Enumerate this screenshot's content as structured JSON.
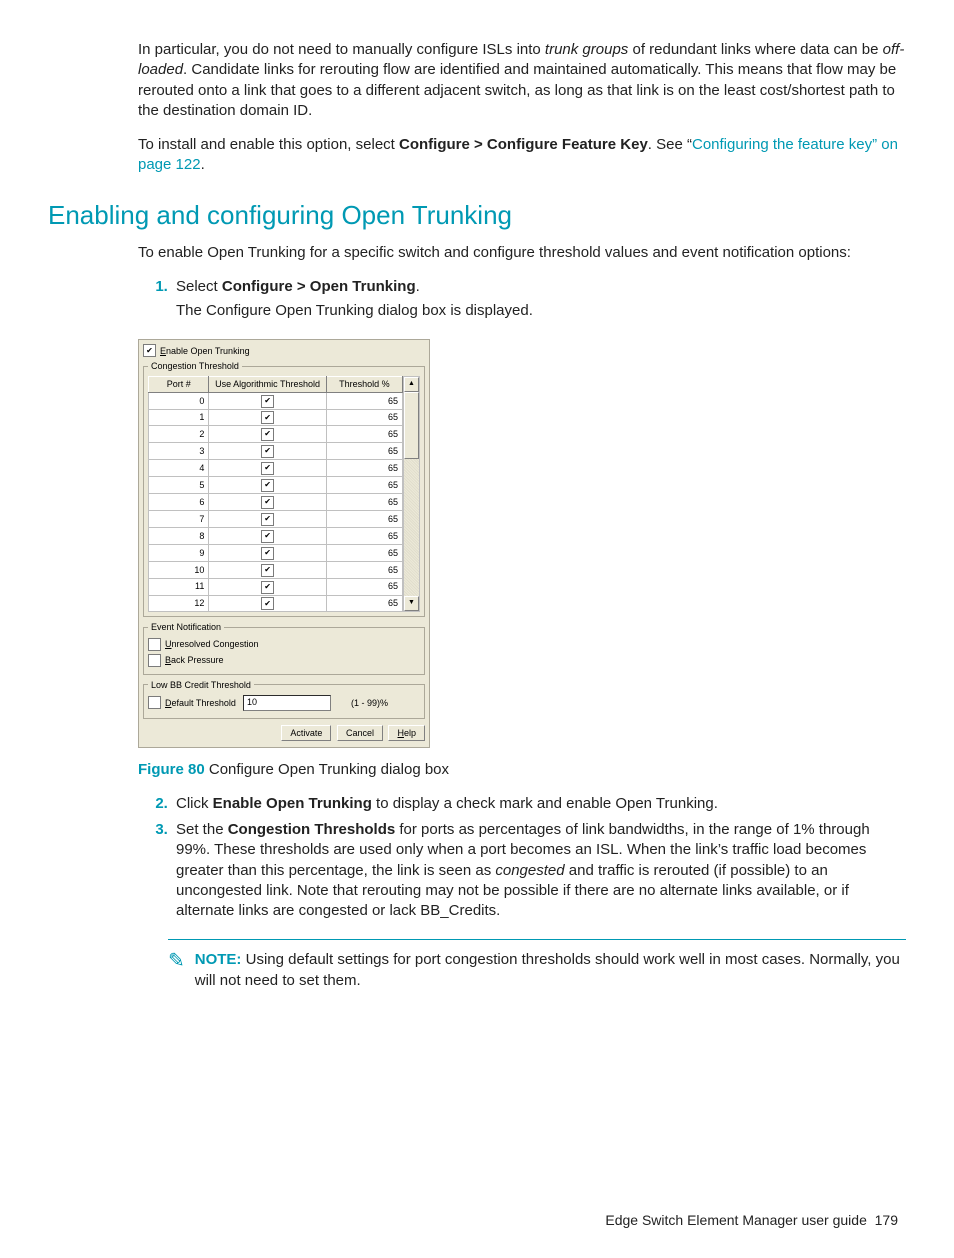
{
  "intro": {
    "p1_a": "In particular, you do not need to manually configure ISLs into ",
    "p1_em1": "trunk groups",
    "p1_b": " of redundant links where data can be ",
    "p1_em2": "off-loaded",
    "p1_c": ". Candidate links for rerouting flow are identified and maintained automatically. This means that flow may be rerouted onto a link that goes to a different adjacent switch, as long as that link is on the least cost/shortest path to the destination domain ID.",
    "p2_a": "To install and enable this option, select ",
    "p2_bold": "Configure > Configure Feature Key",
    "p2_b": ". See “",
    "p2_link": "Configuring the feature key” on page 122",
    "p2_c": "."
  },
  "heading": "Enabling and configuring Open Trunking",
  "lead": "To enable Open Trunking for a specific switch and configure threshold values and event notification options:",
  "step1": {
    "a": "Select ",
    "bold": "Configure > Open Trunking",
    "b": ".",
    "body": "The Configure Open Trunking dialog box is displayed."
  },
  "dialog": {
    "enable_prefix": "E",
    "enable_rest": "nable Open Trunking",
    "group_threshold": "Congestion Threshold",
    "col_port": "Port  #",
    "col_algo": "Use Algorithmic Threshold",
    "col_pct": "Threshold %",
    "rows": [
      {
        "port": "0",
        "pct": "65"
      },
      {
        "port": "1",
        "pct": "65"
      },
      {
        "port": "2",
        "pct": "65"
      },
      {
        "port": "3",
        "pct": "65"
      },
      {
        "port": "4",
        "pct": "65"
      },
      {
        "port": "5",
        "pct": "65"
      },
      {
        "port": "6",
        "pct": "65"
      },
      {
        "port": "7",
        "pct": "65"
      },
      {
        "port": "8",
        "pct": "65"
      },
      {
        "port": "9",
        "pct": "65"
      },
      {
        "port": "10",
        "pct": "65"
      },
      {
        "port": "11",
        "pct": "65"
      },
      {
        "port": "12",
        "pct": "65"
      }
    ],
    "group_event": "Event Notification",
    "unresolved_prefix": "U",
    "unresolved_rest": "nresolved Congestion",
    "back_prefix": "B",
    "back_rest": "ack Pressure",
    "group_bb": "Low BB Credit Threshold",
    "default_prefix": "D",
    "default_rest": "efault Threshold",
    "default_value": "10",
    "range": "(1 - 99)%",
    "btn_activate": "Activate",
    "btn_cancel": "Cancel",
    "btn_help_prefix": "H",
    "btn_help_rest": "elp"
  },
  "figure": {
    "label": "Figure 80",
    "caption": " Configure Open Trunking dialog box"
  },
  "step2": {
    "a": "Click ",
    "bold": "Enable Open Trunking",
    "b": " to display a check mark and enable Open Trunking."
  },
  "step3": {
    "a": "Set the ",
    "bold": "Congestion Thresholds",
    "b": " for ports as percentages of link bandwidths, in the range of 1% through 99%. These thresholds are used only when a port becomes an ISL. When the link’s traffic load becomes greater than this percentage, the link is seen as ",
    "em": "congested",
    "c": " and traffic is rerouted (if possible) to an uncongested link. Note that rerouting may not be possible if there are no alternate links available, or if alternate links are congested or lack BB_Credits."
  },
  "note": {
    "label": "NOTE:",
    "text": "   Using default settings for port congestion thresholds should work well in most cases. Normally, you will not need to set them."
  },
  "footer": {
    "title": "Edge Switch Element Manager user guide",
    "page": "179"
  }
}
